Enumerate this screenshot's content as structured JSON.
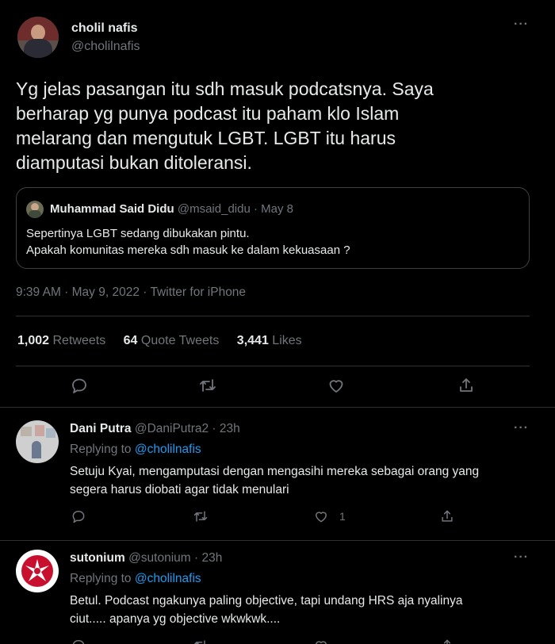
{
  "main_tweet": {
    "author_name": "cholil nafis",
    "author_handle": "@cholilnafis",
    "text_lines": [
      "Yg jelas pasangan itu sdh masuk podcatsnya. Saya",
      "berharap yg punya podcast itu paham klo Islam",
      "melarang dan mengutuk LGBT. LGBT itu harus",
      "diamputasi bukan ditoleransi."
    ],
    "quote": {
      "author_name": "Muhammad Said Didu",
      "author_handle": "@msaid_didu",
      "time": "· May 8",
      "lines": [
        "Sepertinya LGBT sedang dibukakan pintu.",
        "Apakah komunitas mereka sdh masuk ke dalam kekuasaan ?"
      ]
    },
    "meta": "9:39 AM · May 9, 2022 · Twitter for iPhone",
    "stats": {
      "retweets_count": "1,002",
      "retweets_label": "Retweets",
      "quotes_count": "64",
      "quotes_label": "Quote Tweets",
      "likes_count": "3,441",
      "likes_label": "Likes"
    }
  },
  "replies": [
    {
      "author_name": "Dani Putra",
      "author_handle": "@DaniPutra2",
      "time": "· 23h",
      "replying_label": "Replying to",
      "replying_handle": "@cholilnafis",
      "lines": [
        "Setuju Kyai, mengamputasi dengan mengasihi mereka sebagai orang yang",
        "segera harus diobati agar tidak menulari"
      ],
      "like_count": "1"
    },
    {
      "author_name": "sutonium",
      "author_handle": "@sutonium",
      "time": "· 23h",
      "replying_label": "Replying to",
      "replying_handle": "@cholilnafis",
      "lines": [
        "Betul. Podcast ngakunya paling objective, tapi undang HRS aja nyalinya",
        "ciut..... apanya yg objective wkwkwk...."
      ]
    }
  ],
  "more_icon": "···"
}
